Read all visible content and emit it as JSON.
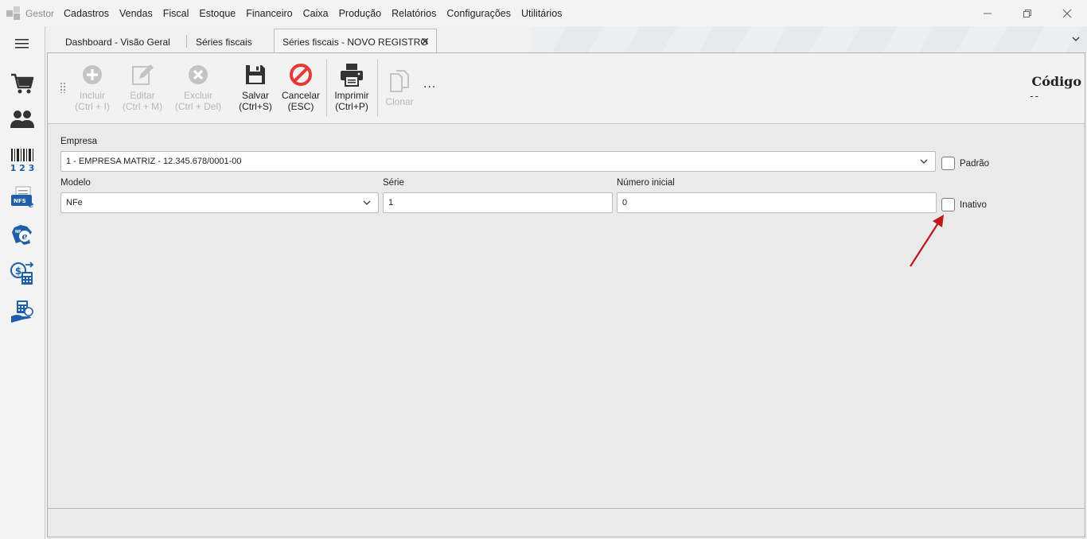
{
  "app": {
    "name": "Gestor"
  },
  "menu": [
    "Cadastros",
    "Vendas",
    "Fiscal",
    "Estoque",
    "Financeiro",
    "Caixa",
    "Produção",
    "Relatórios",
    "Configurações",
    "Utilitários"
  ],
  "tabs": [
    {
      "label": "Dashboard - Visão Geral"
    },
    {
      "label": "Séries fiscais"
    },
    {
      "label": "Séries fiscais - NOVO REGISTRO",
      "active": true,
      "close": "✕"
    }
  ],
  "toolbar": {
    "incluir": {
      "line1": "Incluir",
      "line2": "(Ctrl + I)"
    },
    "editar": {
      "line1": "Editar",
      "line2": "(Ctrl + M)"
    },
    "excluir": {
      "line1": "Excluir",
      "line2": "(Ctrl + Del)"
    },
    "salvar": {
      "line1": "Salvar",
      "line2": "(Ctrl+S)"
    },
    "cancelar": {
      "line1": "Cancelar",
      "line2": "(ESC)"
    },
    "imprimir": {
      "line1": "Imprimir",
      "line2": "(Ctrl+P)"
    },
    "clonar": {
      "line1": "Clonar"
    },
    "more": "...",
    "codigo_label": "Código",
    "codigo_value": "--"
  },
  "form": {
    "empresa": {
      "label": "Empresa",
      "value": "1 - EMPRESA MATRIZ - 12.345.678/0001-00"
    },
    "padrao": {
      "label": "Padrão"
    },
    "modelo": {
      "label": "Modelo",
      "value": "NFe"
    },
    "serie": {
      "label": "Série",
      "value": "1"
    },
    "numero_inicial": {
      "label": "Número inicial",
      "value": "0"
    },
    "inativo": {
      "label": "Inativo"
    }
  },
  "sidebar_icons": [
    "menu-icon",
    "cart-icon",
    "people-icon",
    "barcode-icon",
    "nfse-icon",
    "nfe-icon",
    "money-calculator-icon",
    "hand-calculator-icon"
  ],
  "colors": {
    "cancel_red": "#e53935",
    "icon_dark": "#333333",
    "icon_blue": "#1e5fa8",
    "annotation_red": "#c0161c"
  }
}
